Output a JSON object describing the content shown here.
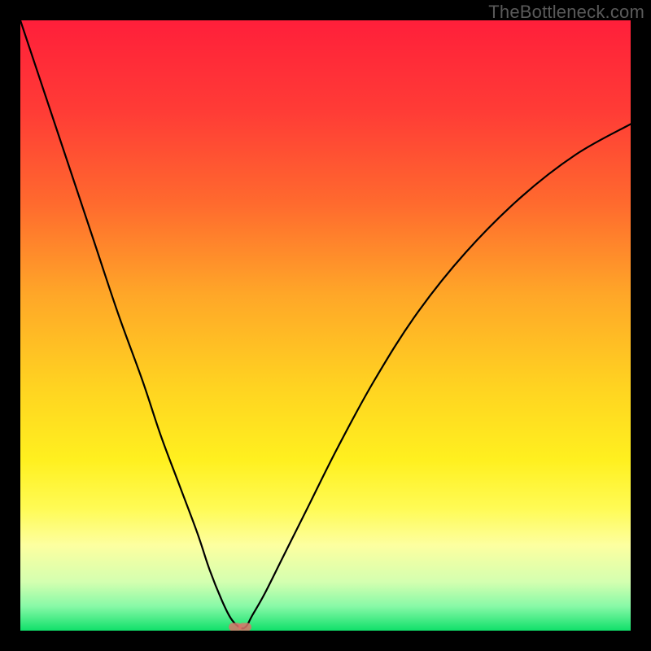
{
  "watermark": "TheBottleneck.com",
  "chart_data": {
    "type": "line",
    "title": "",
    "xlabel": "",
    "ylabel": "",
    "xlim": [
      0,
      100
    ],
    "ylim": [
      0,
      100
    ],
    "gradient_stops": [
      {
        "offset": 0.0,
        "color": "#ff1f3a"
      },
      {
        "offset": 0.15,
        "color": "#ff3c36"
      },
      {
        "offset": 0.3,
        "color": "#ff6a2e"
      },
      {
        "offset": 0.45,
        "color": "#ffa728"
      },
      {
        "offset": 0.6,
        "color": "#ffd321"
      },
      {
        "offset": 0.72,
        "color": "#fff01f"
      },
      {
        "offset": 0.8,
        "color": "#fffb55"
      },
      {
        "offset": 0.86,
        "color": "#fdffa0"
      },
      {
        "offset": 0.92,
        "color": "#d4ffb0"
      },
      {
        "offset": 0.96,
        "color": "#88f9a7"
      },
      {
        "offset": 1.0,
        "color": "#10e06a"
      }
    ],
    "series": [
      {
        "name": "bottleneck-curve",
        "x": [
          0,
          4,
          8,
          12,
          16,
          20,
          23,
          26,
          29,
          31,
          33,
          34.5,
          36,
          37,
          38,
          40,
          43,
          47,
          52,
          58,
          65,
          73,
          82,
          91,
          100
        ],
        "y": [
          100,
          88,
          76,
          64,
          52,
          41,
          32,
          24,
          16,
          10,
          5,
          2,
          0.5,
          0.7,
          2.5,
          6,
          12,
          20,
          30,
          41,
          52,
          62,
          71,
          78,
          83
        ]
      }
    ],
    "markers": [
      {
        "name": "min-marker-1",
        "x": 35.2,
        "y": 0.6
      },
      {
        "name": "min-marker-2",
        "x": 36.8,
        "y": 0.6
      }
    ]
  }
}
